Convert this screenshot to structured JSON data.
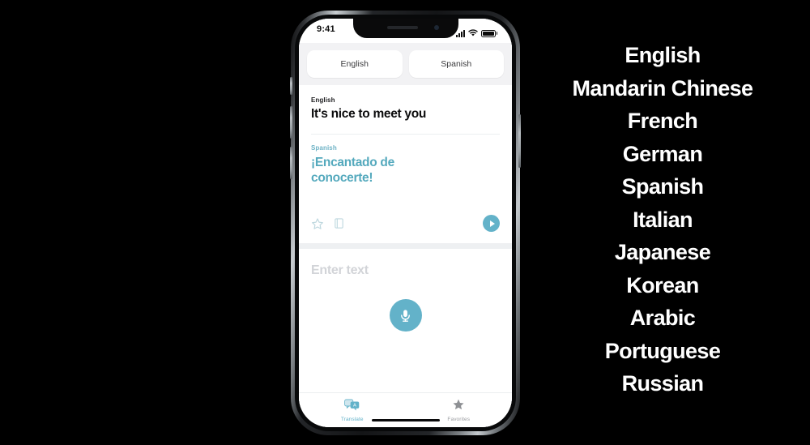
{
  "phone": {
    "status_bar": {
      "time": "9:41",
      "signal_icon": "cellular-signal-icon",
      "wifi_icon": "wifi-icon",
      "battery_icon": "battery-icon"
    },
    "language_selector": {
      "source_button": "English",
      "target_button": "Spanish"
    },
    "translation_card": {
      "source_label": "English",
      "source_text": "It's nice to meet you",
      "target_label": "Spanish",
      "target_text": "¡Encantado de conocerte!",
      "actions": {
        "favorite_icon": "star-outline-icon",
        "dictionary_icon": "book-outline-icon",
        "play_icon": "play-circle-icon"
      }
    },
    "input_area": {
      "placeholder": "Enter text",
      "mic_icon": "microphone-icon"
    },
    "tab_bar": [
      {
        "label": "Translate",
        "icon": "speech-bubbles-icon",
        "active": true
      },
      {
        "label": "Favorites",
        "icon": "star-filled-icon",
        "active": false
      }
    ],
    "home_indicator": "home-indicator"
  },
  "languages": [
    "English",
    "Mandarin Chinese",
    "French",
    "German",
    "Spanish",
    "Italian",
    "Japanese",
    "Korean",
    "Arabic",
    "Portuguese",
    "Russian"
  ],
  "colors": {
    "background": "#000000",
    "accent_teal": "#63b2c9",
    "text_primary": "#0b0b0c",
    "placeholder": "#d2d4d8",
    "chrome_gray": "#f2f2f4"
  }
}
